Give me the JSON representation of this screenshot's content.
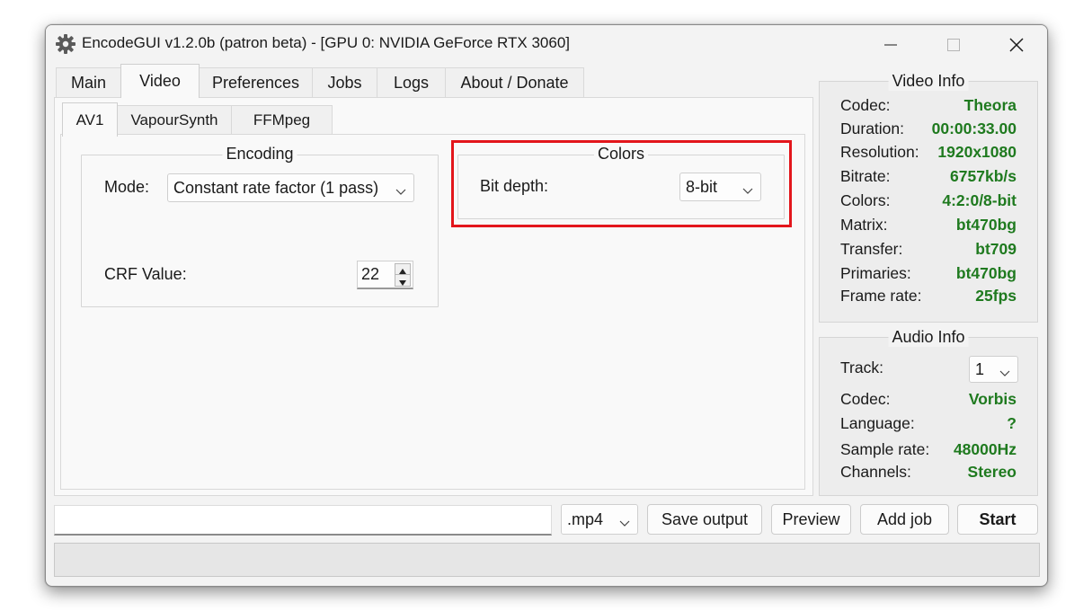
{
  "window": {
    "title": "EncodeGUI v1.2.0b (patron beta) - [GPU 0: NVIDIA GeForce RTX 3060]",
    "controls": {
      "minimize": "minimize-icon",
      "maximize": "maximize-icon",
      "close": "close-icon"
    }
  },
  "main_tabs": [
    "Main",
    "Video",
    "Preferences",
    "Jobs",
    "Logs",
    "About / Donate"
  ],
  "active_main_tab": "Video",
  "sub_tabs": [
    "AV1",
    "VapourSynth",
    "FFMpeg"
  ],
  "active_sub_tab": "AV1",
  "encoding": {
    "title": "Encoding",
    "mode_label": "Mode:",
    "mode_value": "Constant rate factor (1 pass)",
    "crf_label": "CRF Value:",
    "crf_value": "22"
  },
  "colors": {
    "title": "Colors",
    "bit_depth_label": "Bit depth:",
    "bit_depth_value": "8-bit",
    "highlight_color": "#e3161c"
  },
  "video_info": {
    "title": "Video Info",
    "rows": [
      {
        "label": "Codec:",
        "value": "Theora"
      },
      {
        "label": "Duration:",
        "value": "00:00:33.00"
      },
      {
        "label": "Resolution:",
        "value": "1920x1080"
      },
      {
        "label": "Bitrate:",
        "value": "6757kb/s"
      },
      {
        "label": "Colors:",
        "value": "4:2:0/8-bit"
      },
      {
        "label": "Matrix:",
        "value": "bt470bg"
      },
      {
        "label": "Transfer:",
        "value": "bt709"
      },
      {
        "label": "Primaries:",
        "value": "bt470bg"
      },
      {
        "label": "Frame rate:",
        "value": "25fps"
      }
    ]
  },
  "audio_info": {
    "title": "Audio Info",
    "track_label": "Track:",
    "track_value": "1",
    "rows": [
      {
        "label": "Codec:",
        "value": "Vorbis"
      },
      {
        "label": "Language:",
        "value": "?"
      },
      {
        "label": "Sample rate:",
        "value": "48000Hz"
      },
      {
        "label": "Channels:",
        "value": "Stereo"
      }
    ]
  },
  "bottom": {
    "output_path": "",
    "container": ".mp4",
    "save_output": "Save output",
    "preview": "Preview",
    "add_job": "Add job",
    "start": "Start",
    "status": ""
  },
  "colors_palette": {
    "value_green": "#1f7a1f",
    "window_bg": "#f3f3f3"
  }
}
